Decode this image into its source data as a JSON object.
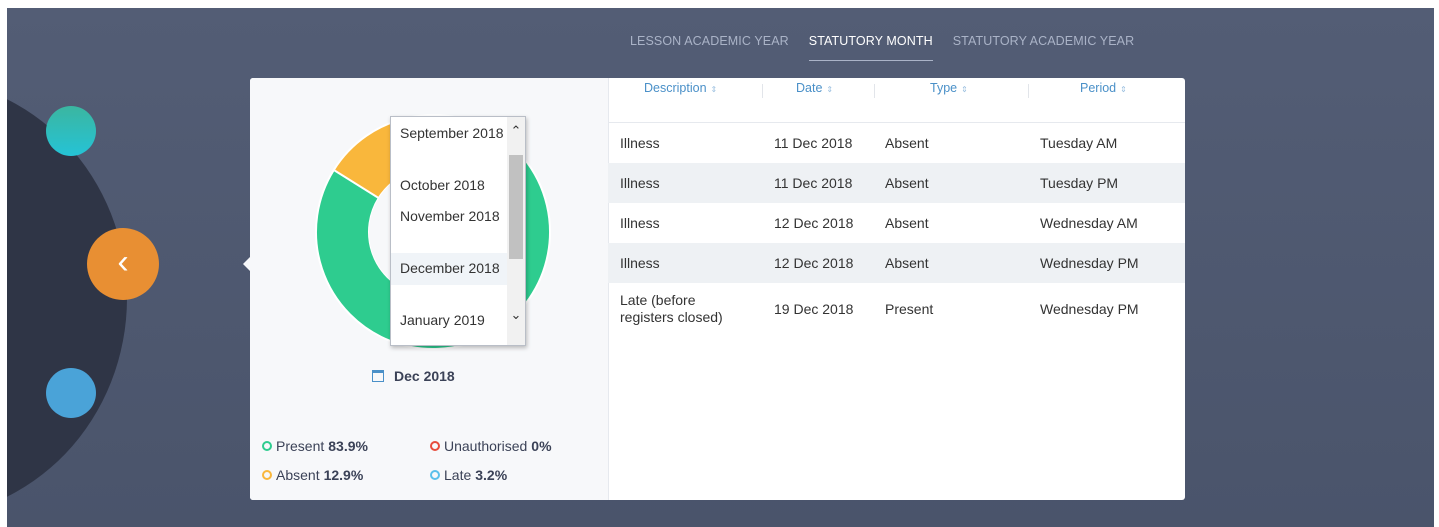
{
  "tabs": [
    {
      "label": "LESSON ACADEMIC YEAR",
      "active": false
    },
    {
      "label": "STATUTORY MONTH",
      "active": true
    },
    {
      "label": "STATUTORY ACADEMIC YEAR",
      "active": false
    }
  ],
  "nav": {
    "back_icon": "chevron-left-icon",
    "back_glyph": "‹"
  },
  "donut": {
    "slices": [
      {
        "label": "Present",
        "value": 83.9,
        "color": "#2ecc8f"
      },
      {
        "label": "Absent",
        "value": 12.9,
        "color": "#f9b73c"
      },
      {
        "label": "Late",
        "value": 3.2,
        "color": "#5bc0eb"
      },
      {
        "label": "Unauthorised",
        "value": 0,
        "color": "#e74c3c"
      }
    ]
  },
  "month_dropdown": {
    "options": [
      "September 2018",
      "October 2018",
      "November 2018",
      "December 2018",
      "January 2019"
    ],
    "selected": "December 2018",
    "up_glyph": "⌃",
    "down_glyph": "⌄"
  },
  "selected_month": {
    "label": "Dec 2018",
    "icon": "calendar-icon"
  },
  "legend": [
    {
      "label": "Present",
      "value": "83.9%",
      "color": "#2ecc8f"
    },
    {
      "label": "Unauthorised",
      "value": "0%",
      "color": "#e74c3c"
    },
    {
      "label": "Absent",
      "value": "12.9%",
      "color": "#f9b73c"
    },
    {
      "label": "Late",
      "value": "3.2%",
      "color": "#5bc0eb"
    }
  ],
  "table": {
    "headers": [
      "Description",
      "Date",
      "Type",
      "Period"
    ],
    "sort_glyph": "⇕",
    "rows": [
      [
        "Illness",
        "11 Dec 2018",
        "Absent",
        "Tuesday AM"
      ],
      [
        "Illness",
        "11 Dec 2018",
        "Absent",
        "Tuesday PM"
      ],
      [
        "Illness",
        "12 Dec 2018",
        "Absent",
        "Wednesday AM"
      ],
      [
        "Illness",
        "12 Dec 2018",
        "Absent",
        "Wednesday PM"
      ],
      [
        "Late (before registers closed)",
        "19 Dec 2018",
        "Present",
        "Wednesday PM"
      ]
    ]
  }
}
